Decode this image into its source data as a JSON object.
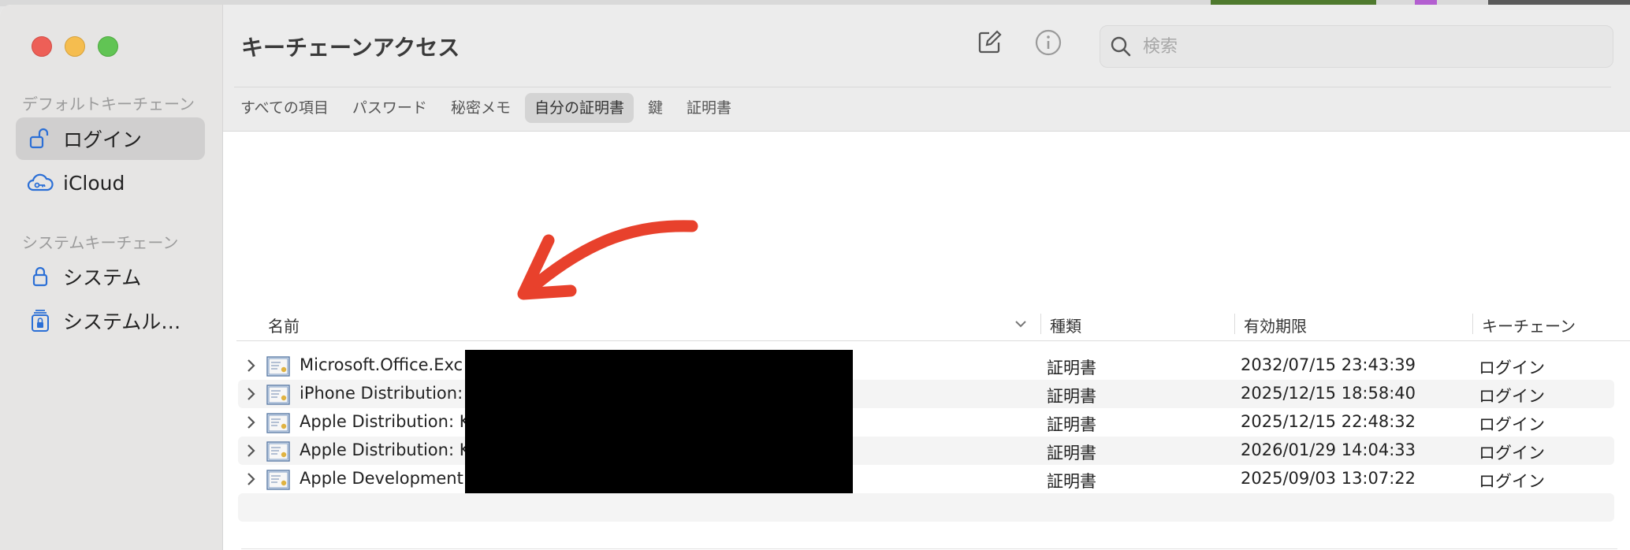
{
  "app": {
    "title": "キーチェーンアクセス"
  },
  "sidebar": {
    "default_section": "デフォルトキーチェーン",
    "system_section": "システムキーチェーン",
    "items": [
      {
        "label": "ログイン",
        "icon": "lock-open-icon",
        "active": true
      },
      {
        "label": "iCloud",
        "icon": "icloud-key-icon",
        "active": false
      },
      {
        "label": "システム",
        "icon": "lock-icon",
        "active": false
      },
      {
        "label": "システムル…",
        "icon": "system-roots-icon",
        "active": false
      }
    ]
  },
  "toolbar": {
    "compose_icon": "compose-icon",
    "info_icon": "info-icon"
  },
  "search": {
    "placeholder": "検索",
    "value": ""
  },
  "tabs": [
    {
      "label": "すべての項目",
      "active": false
    },
    {
      "label": "パスワード",
      "active": false
    },
    {
      "label": "秘密メモ",
      "active": false
    },
    {
      "label": "自分の証明書",
      "active": true
    },
    {
      "label": "鍵",
      "active": false
    },
    {
      "label": "証明書",
      "active": false
    }
  ],
  "table": {
    "columns": {
      "name": "名前",
      "kind": "種類",
      "expires": "有効期限",
      "keychain": "キーチェーン"
    },
    "rows": [
      {
        "name": "Microsoft.Office.Exc",
        "kind": "証明書",
        "expires": "2032/07/15 23:43:39",
        "keychain": "ログイン"
      },
      {
        "name": "iPhone Distribution:",
        "kind": "証明書",
        "expires": "2025/12/15 18:58:40",
        "keychain": "ログイン"
      },
      {
        "name": "Apple Distribution: K",
        "kind": "証明書",
        "expires": "2025/12/15 22:48:32",
        "keychain": "ログイン"
      },
      {
        "name": "Apple Distribution: K",
        "kind": "証明書",
        "expires": "2026/01/29 14:04:33",
        "keychain": "ログイン"
      },
      {
        "name": "Apple Development:",
        "kind": "証明書",
        "expires": "2025/09/03 13:07:22",
        "keychain": "ログイン"
      }
    ]
  },
  "colors": {
    "annotation_arrow": "#e8412c",
    "active_tab": "#d4d4d4",
    "sidebar_active": "#d0cfcf",
    "accent_icon": "#2b6fd6"
  }
}
